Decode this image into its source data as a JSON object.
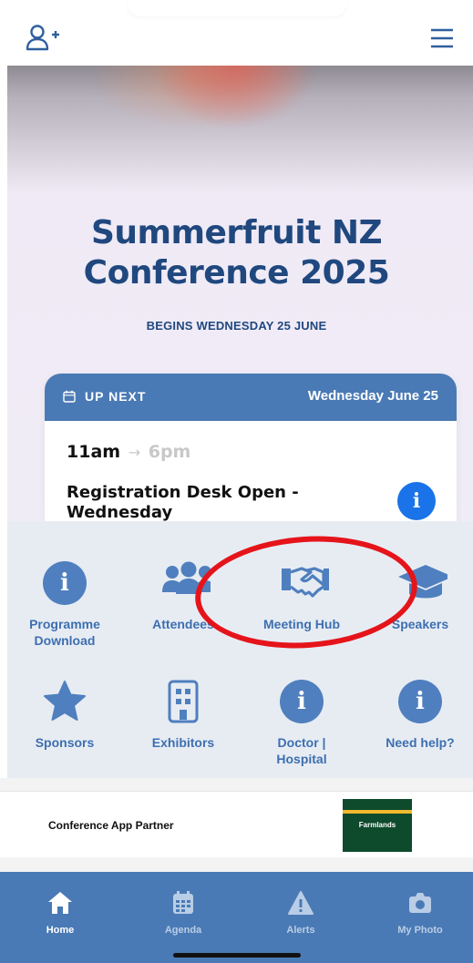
{
  "header": {
    "add_user_icon": "add-user-icon",
    "menu_icon": "hamburger-menu-icon"
  },
  "hero": {
    "title_line1": "Summerfruit NZ",
    "title_line2": "Conference 2025",
    "subtitle": "BEGINS WEDNESDAY 25 JUNE"
  },
  "up_next": {
    "label": "UP NEXT",
    "date": "Wednesday June 25",
    "start_time": "11am",
    "arrow": "→",
    "end_time": "6pm",
    "title": "Registration Desk Open - Wednesday",
    "info_glyph": "i"
  },
  "tiles": [
    {
      "label": "Programme Download",
      "icon": "info-icon"
    },
    {
      "label": "Attendees",
      "icon": "people-icon"
    },
    {
      "label": "Meeting Hub",
      "icon": "handshake-icon"
    },
    {
      "label": "Speakers",
      "icon": "graduation-cap-icon"
    },
    {
      "label": "Sponsors",
      "icon": "star-icon"
    },
    {
      "label": "Exhibitors",
      "icon": "building-icon"
    },
    {
      "label": "Doctor | Hospital",
      "icon": "info-icon"
    },
    {
      "label": "Need help?",
      "icon": "info-icon"
    }
  ],
  "partner": {
    "label": "Conference App Partner",
    "logo_text": "Farmlands"
  },
  "tabs": [
    {
      "label": "Home",
      "icon": "home-icon",
      "active": true
    },
    {
      "label": "Agenda",
      "icon": "calendar-icon",
      "active": false
    },
    {
      "label": "Alerts",
      "icon": "alert-icon",
      "active": false
    },
    {
      "label": "My Photo",
      "icon": "camera-icon",
      "active": false
    }
  ],
  "colors": {
    "brand_blue": "#4a7ab5",
    "title_navy": "#20487f",
    "info_blue": "#1a73e8",
    "annotation_red": "#e5141a"
  }
}
